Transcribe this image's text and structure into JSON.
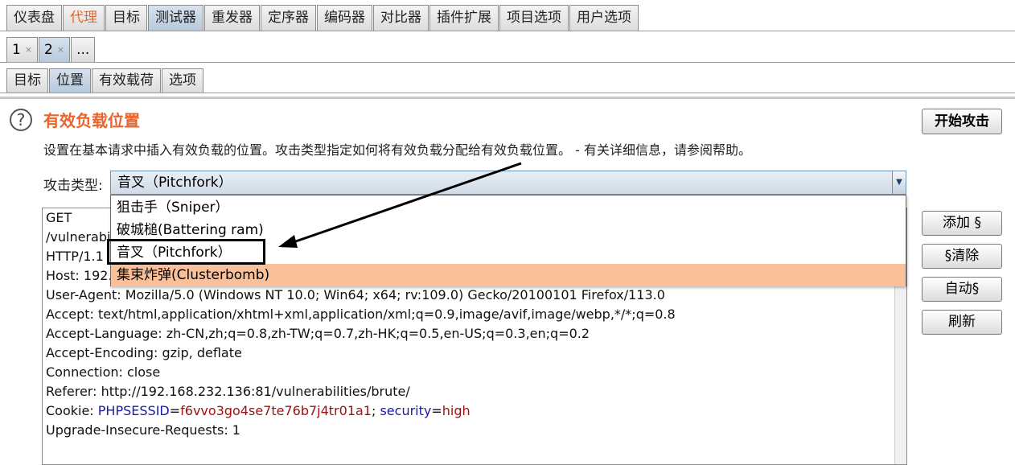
{
  "main_tabs": [
    "仪表盘",
    "代理",
    "目标",
    "测试器",
    "重发器",
    "定序器",
    "编码器",
    "对比器",
    "插件扩展",
    "项目选项",
    "用户选项"
  ],
  "main_tab_states": {
    "active": "测试器",
    "highlighted": "代理"
  },
  "attack_tabs": [
    {
      "label": "1",
      "close": "×"
    },
    {
      "label": "2",
      "close": "×"
    },
    {
      "label": "..."
    }
  ],
  "inner_tabs": [
    "目标",
    "位置",
    "有效载荷",
    "选项"
  ],
  "positions": {
    "help_glyph": "?",
    "title": "有效负载位置",
    "description": "设置在基本请求中插入有效负载的位置。攻击类型指定如何将有效负载分配给有效负载位置。 - 有关详细信息，请参阅帮助。",
    "start_attack": "开始攻击",
    "attack_type_label": "攻击类型:",
    "attack_type_selected": "音叉（Pitchfork）",
    "attack_type_options": [
      "狙击手（Sniper）",
      "破城槌(Battering ram)",
      "音叉（Pitchfork）",
      "集束炸弹(Clusterbomb)"
    ],
    "hovered_option": "集束炸弹(Clusterbomb)",
    "side_buttons": [
      "添加 §",
      "§清除",
      "自动§",
      "刷新"
    ]
  },
  "request": {
    "line1": "GET",
    "line2": "/vulnerabi",
    "line3": "HTTP/1.1",
    "line4": "Host: 192.",
    "user_agent": "User-Agent: Mozilla/5.0 (Windows NT 10.0; Win64; x64; rv:109.0) Gecko/20100101 Firefox/113.0",
    "accept": "Accept: text/html,application/xhtml+xml,application/xml;q=0.9,image/avif,image/webp,*/*;q=0.8",
    "accept_language": "Accept-Language: zh-CN,zh;q=0.8,zh-TW;q=0.7,zh-HK;q=0.5,en-US;q=0.3,en;q=0.2",
    "accept_encoding": "Accept-Encoding: gzip, deflate",
    "connection": "Connection: close",
    "referer": "Referer: http://192.168.232.136:81/vulnerabilities/brute/",
    "cookie_label": "Cookie: ",
    "cookie_k1": "PHPSESSID",
    "cookie_eq": "=",
    "cookie_v1": "f6vvo3go4se7te76b7j4tr01a1",
    "cookie_sep": "; ",
    "cookie_k2": "security",
    "cookie_v2": "high",
    "upgrade": "Upgrade-Insecure-Requests: 1"
  },
  "colors": {
    "accent": "#e8642a",
    "hover": "#f9c09a",
    "active_tab": "#b8c9da"
  }
}
